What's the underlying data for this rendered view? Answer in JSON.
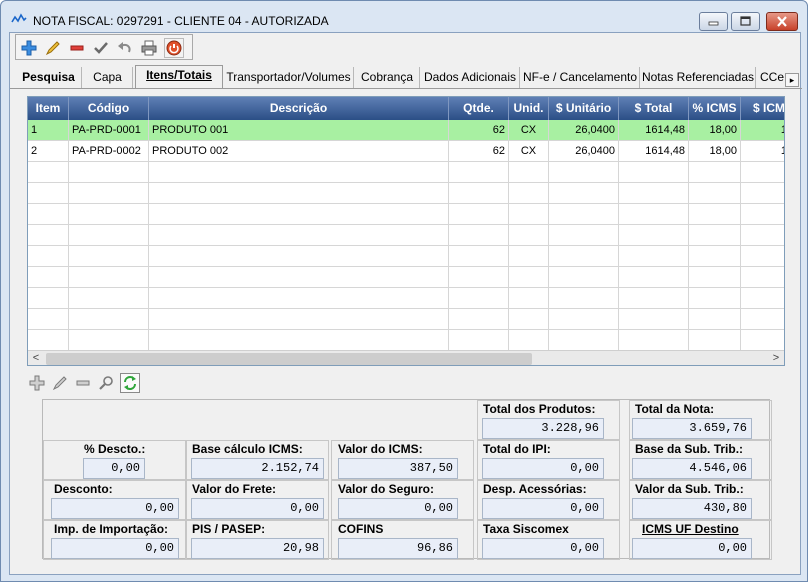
{
  "window": {
    "title": "NOTA FISCAL: 0297291 - CLIENTE 04 - AUTORIZADA"
  },
  "toolbar": [
    "add-icon",
    "edit-icon",
    "remove-icon",
    "confirm-icon",
    "undo-icon",
    "print-icon",
    "cancel-icon"
  ],
  "tabs": [
    "Pesquisa",
    "Capa",
    "Itens/Totais",
    "Transportador/Volumes",
    "Cobrança",
    "Dados Adicionais",
    "NF-e / Cancelamento",
    "Notas Referenciadas",
    "CCe"
  ],
  "active_tab": "Itens/Totais",
  "grid": {
    "columns": [
      "Item",
      "Código",
      "Descrição",
      "Qtde.",
      "Unid.",
      "$ Unitário",
      "$ Total",
      "% ICMS",
      "$ ICM"
    ],
    "rows": [
      [
        "1",
        "PA-PRD-0001",
        "PRODUTO 001",
        "62",
        "CX",
        "26,0400",
        "1614,48",
        "18,00",
        "1"
      ],
      [
        "2",
        "PA-PRD-0002",
        "PRODUTO 002",
        "62",
        "CX",
        "26,0400",
        "1614,48",
        "18,00",
        "1"
      ]
    ],
    "selected_row": 0
  },
  "grid_tools": [
    "add-icon",
    "edit-icon",
    "remove-icon",
    "search-icon",
    "refresh-icon"
  ],
  "totals": {
    "total_produtos": {
      "label": "Total dos Produtos:",
      "value": "3.228,96"
    },
    "total_nota": {
      "label": "Total da Nota:",
      "value": "3.659,76"
    },
    "desconto_pct": {
      "label": "% Descto.:",
      "value": "0,00"
    },
    "base_icms": {
      "label": "Base cálculo ICMS:",
      "value": "2.152,74"
    },
    "valor_icms": {
      "label": "Valor do ICMS:",
      "value": "387,50"
    },
    "total_ipi": {
      "label": "Total do IPI:",
      "value": "0,00"
    },
    "base_sub_trib": {
      "label": "Base da Sub. Trib.:",
      "value": "4.546,06"
    },
    "desconto": {
      "label": "Desconto:",
      "value": "0,00"
    },
    "valor_frete": {
      "label": "Valor do Frete:",
      "value": "0,00"
    },
    "valor_seguro": {
      "label": "Valor do Seguro:",
      "value": "0,00"
    },
    "desp_acessorias": {
      "label": "Desp. Acessórias:",
      "value": "0,00"
    },
    "valor_sub_trib": {
      "label": "Valor da Sub. Trib.:",
      "value": "430,80"
    },
    "imp_importacao": {
      "label": "Imp. de Importação:",
      "value": "0,00"
    },
    "pis_pasep": {
      "label": "PIS / PASEP:",
      "value": "20,98"
    },
    "cofins": {
      "label": "COFINS",
      "value": "96,86"
    },
    "taxa_siscomex": {
      "label": "Taxa Siscomex",
      "value": "0,00"
    },
    "icms_uf_destino": {
      "label": "ICMS UF Destino",
      "value": "0,00"
    }
  }
}
